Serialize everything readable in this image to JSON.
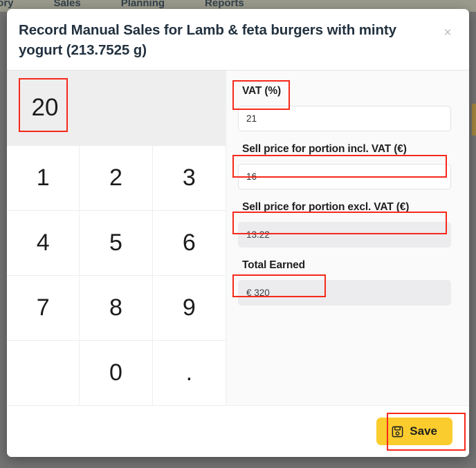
{
  "background": {
    "nav_items": [
      "ntory",
      "Sales",
      "Planning",
      "Reports"
    ]
  },
  "modal": {
    "title_prefix": "Record Manual Sales for Lamb & feta burgers with minty yogurt ",
    "title_full": "Record Manual Sales for Lamb & feta burgers with minty yogurt (213.7525 g)",
    "title_main": "Record Manual Sales for Lamb & feta burgers with minty yogurt",
    "weight": "(213.7525 g)",
    "close_label": "×"
  },
  "numpad": {
    "display_value": "20",
    "keys": [
      "1",
      "2",
      "3",
      "4",
      "5",
      "6",
      "7",
      "8",
      "9",
      "",
      "0",
      "."
    ]
  },
  "fields": [
    {
      "label": "VAT (%)",
      "value": "21",
      "readonly": false,
      "name": "vat-percent"
    },
    {
      "label": "Sell price for portion incl. VAT (€)",
      "value": "16",
      "readonly": false,
      "name": "sell-price-incl-vat"
    },
    {
      "label": "Sell price for portion excl. VAT (€)",
      "value": "13.22",
      "readonly": true,
      "name": "sell-price-excl-vat"
    },
    {
      "label": "Total Earned",
      "value": "€ 320",
      "readonly": true,
      "name": "total-earned"
    }
  ],
  "footer": {
    "save_label": "Save"
  },
  "colors": {
    "accent_yellow": "#facc2e",
    "annotation_red": "#f6281a",
    "title_navy": "#22313f",
    "panel_bg": "#fafafa",
    "display_bg": "#eeeeee"
  }
}
